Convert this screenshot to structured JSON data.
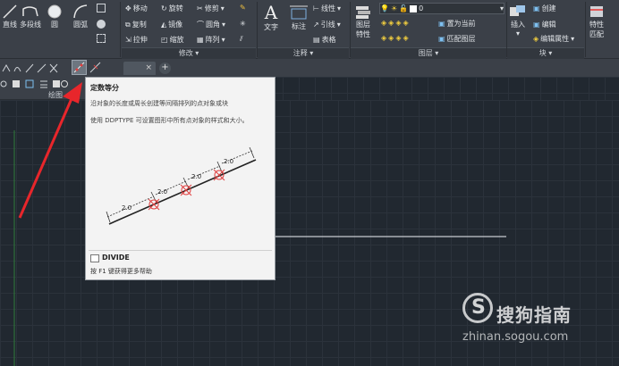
{
  "ribbon": {
    "draw_tools": {
      "line": "直线",
      "polyline": "多段线",
      "circle": "圆",
      "arc": "圆弧"
    },
    "modify_tools": {
      "move": "移动",
      "rotate": "旋转",
      "trim": "修剪",
      "copy": "复制",
      "mirror": "镜像",
      "fillet": "圆角",
      "stretch": "拉伸",
      "scale": "缩放",
      "array": "阵列",
      "panel_label": "修改"
    },
    "annotation_tools": {
      "text": "文字",
      "dimension": "标注",
      "linear": "线性",
      "leader": "引线",
      "table": "表格",
      "panel_label": "注释"
    },
    "layer_tools": {
      "layer_properties_line1": "图层",
      "layer_properties_line2": "特性",
      "current_layer": "0",
      "set_current": "置为当前",
      "match_layer": "匹配图层",
      "panel_label": "图层"
    },
    "block_tools": {
      "insert": "插入",
      "create": "创建",
      "edit": "编辑",
      "edit_attributes": "编辑属性",
      "panel_label": "块"
    },
    "properties_tools": {
      "match_line1": "特性",
      "match_line2": "匹配"
    },
    "draw_panel_label": "绘图"
  },
  "tabs": {
    "doc_close": "×",
    "new_tab": "+"
  },
  "tooltip": {
    "title": "定数等分",
    "description": "沿对象的长度或周长创建等间隔排列的点对象或块",
    "note": "使用 DDPTYPE 可设置图形中所有点对象的样式和大小。",
    "diagram_labels": [
      "2.0",
      "2.0",
      "2.0",
      "2.0"
    ],
    "command": "DIVIDE",
    "help_hint": "按 F1 键获得更多帮助"
  },
  "watermark": {
    "brand": "搜狗指南",
    "url": "zhinan.sogou.com"
  },
  "colors": {
    "ribbon_bg": "#3b4048",
    "canvas_bg": "#212830",
    "tooltip_bg": "#f3f3f3",
    "arrow_red": "#e8262b",
    "point_marker": "#e04040"
  }
}
